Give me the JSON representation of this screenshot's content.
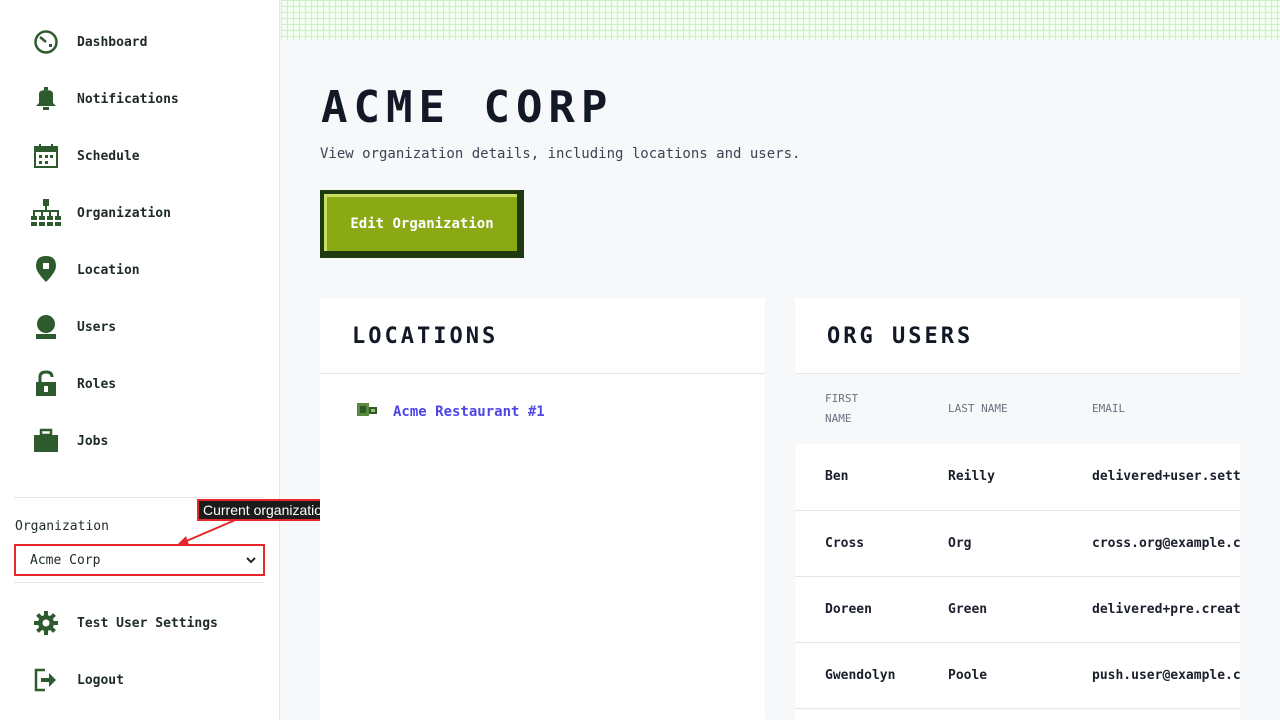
{
  "sidebar": {
    "items": [
      {
        "label": "Dashboard",
        "icon": "dashboard-gauge-icon"
      },
      {
        "label": "Notifications",
        "icon": "bell-icon"
      },
      {
        "label": "Schedule",
        "icon": "calendar-icon"
      },
      {
        "label": "Organization",
        "icon": "org-chart-icon"
      },
      {
        "label": "Location",
        "icon": "map-pin-icon"
      },
      {
        "label": "Users",
        "icon": "user-icon"
      },
      {
        "label": "Roles",
        "icon": "unlock-icon"
      },
      {
        "label": "Jobs",
        "icon": "briefcase-icon"
      }
    ],
    "org_label": "Organization",
    "org_selected": "Acme Corp",
    "footer": [
      {
        "label": "Test User Settings",
        "icon": "gear-icon"
      },
      {
        "label": "Logout",
        "icon": "logout-icon"
      }
    ],
    "tooltip": "Current organization"
  },
  "page": {
    "title": "Acme Corp",
    "subtitle": "View organization details, including locations and users.",
    "edit_button": "Edit Organization"
  },
  "locations": {
    "title": "Locations",
    "items": [
      {
        "name": "Acme Restaurant #1",
        "icon": "store-icon"
      }
    ]
  },
  "org_users": {
    "title": "Org Users",
    "columns": [
      "FIRST NAME",
      "LAST NAME",
      "EMAIL"
    ],
    "rows": [
      [
        "Ben",
        "Reilly",
        "delivered+user.settin"
      ],
      [
        "Cross",
        "Org",
        "cross.org@example.com"
      ],
      [
        "Doreen",
        "Green",
        "delivered+pre.created"
      ],
      [
        "Gwendolyn",
        "Poole",
        "push.user@example.com"
      ]
    ]
  },
  "colors": {
    "accent": "#8aa914",
    "accent_dark": "#203a10",
    "icon_green": "#2e5b2e",
    "link": "#4f46e5",
    "annotation": "#e5262a"
  }
}
